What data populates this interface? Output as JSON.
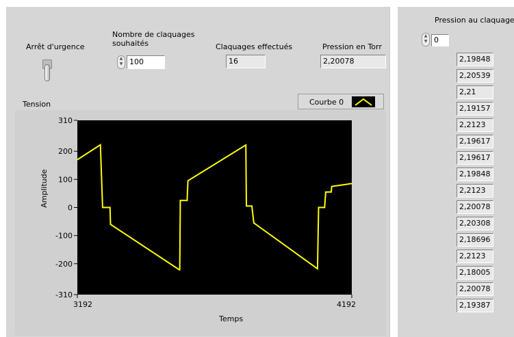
{
  "controls": {
    "emergency_stop_label": "Arrêt d'urgence",
    "claquages_label": "Nombre de claquages\nsouhaités",
    "claquages_value": "100",
    "done_label": "Claquages effectués",
    "done_value": "16",
    "pressure_label": "Pression en Torr",
    "pressure_value": "2,20078"
  },
  "right_panel": {
    "title": "Pression au claquage",
    "index_value": "0",
    "values": [
      "2,19848",
      "2,20539",
      "2,21",
      "2,19157",
      "2,2123",
      "2,19617",
      "2,19617",
      "2,19848",
      "2,2123",
      "2,20078",
      "2,20308",
      "2,18696",
      "2,2123",
      "2,18005",
      "2,20078",
      "2,19387"
    ]
  },
  "chart_data": {
    "type": "line",
    "title": "Tension",
    "xlabel": "Temps",
    "ylabel": "Amplitude",
    "xlim": [
      3192,
      4192
    ],
    "ylim": [
      -310,
      310
    ],
    "x_tick_labels": [
      "3192",
      "4192"
    ],
    "y_tick_labels": [
      "310",
      "200",
      "100",
      "0",
      "-100",
      "-200",
      "-310"
    ],
    "y_ticks": [
      310,
      200,
      100,
      0,
      -100,
      -200,
      -310
    ],
    "legend": "Courbe 0",
    "series": [
      {
        "name": "Courbe 0",
        "color": "#ffff00",
        "x": [
          3192,
          3276,
          3284,
          3284,
          3311,
          3313,
          3564,
          3565,
          3567,
          3567,
          3592,
          3595,
          3806,
          3808,
          3828,
          3835,
          4067,
          4071,
          4093,
          4097,
          4117,
          4119,
          4192
        ],
        "y": [
          170,
          223,
          0,
          0,
          0,
          -60,
          -222,
          -222,
          0,
          25,
          25,
          95,
          222,
          5,
          5,
          -55,
          -218,
          0,
          0,
          55,
          55,
          75,
          85
        ]
      }
    ]
  }
}
